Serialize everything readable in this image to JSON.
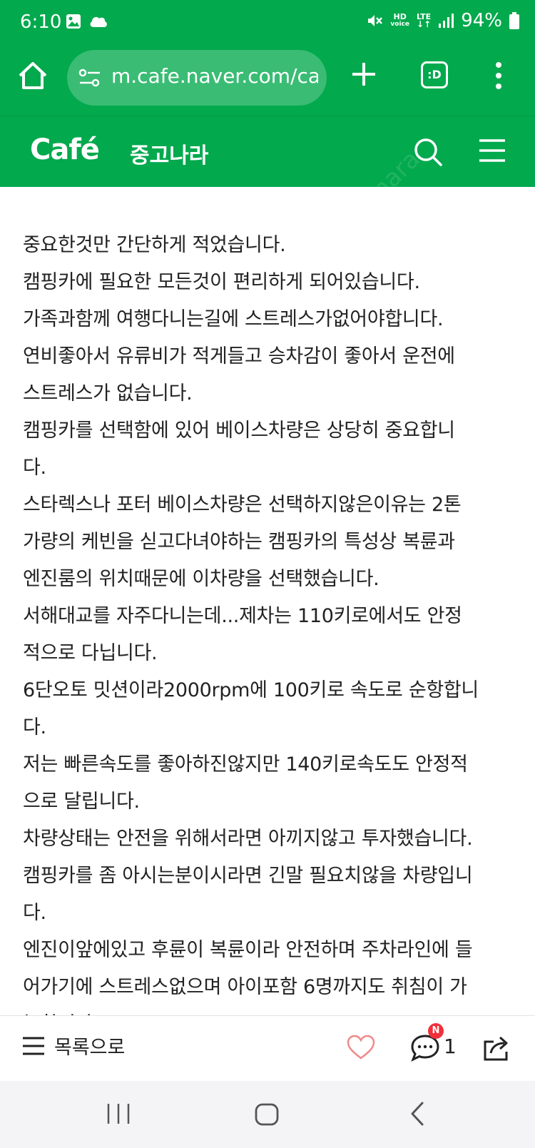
{
  "status_bar": {
    "time": "6:10",
    "hd_voice_label": "HD",
    "hd_voice_sub": "voice",
    "lte_label": "LTE",
    "battery": "94%"
  },
  "browser": {
    "url": "m.cafe.naver.com/ca",
    "tab_count_label": ":D"
  },
  "cafe": {
    "logo": "Café",
    "name": "중고나라"
  },
  "watermark": "joonggonara",
  "article": {
    "lines": [
      "중요한것만 간단하게 적었습니다.",
      "캠핑카에 필요한 모든것이 편리하게 되어있습니다.",
      "가족과함께 여행다니는길에 스트레스가없어야합니다.",
      "연비좋아서 유류비가 적게들고 승차감이 좋아서 운전에",
      "스트레스가 없습니다.",
      "캠핑카를 선택함에 있어 베이스차량은 상당히 중요합니",
      "다.",
      "스타렉스나 포터 베이스차량은 선택하지않은이유는 2톤",
      "가량의 케빈을 싣고다녀야하는 캠핑카의 특성상 복륜과",
      "엔진룸의 위치때문에 이차량을 선택했습니다.",
      "서해대교를 자주다니는데...제차는 110키로에서도 안정",
      "적으로 다닙니다.",
      "6단오토 밋션이라2000rpm에 100키로 속도로 순항합니",
      "다.",
      "저는 빠른속도를 좋아하진않지만 140키로속도도 안정적",
      "으로 달립니다.",
      "차량상태는 안전을 위해서라면 아끼지않고 투자했습니다.",
      "캠핑카를 좀 아시는분이시라면 긴말 필요치않을 차량입니",
      "다.",
      "엔진이앞에있고 후륜이 복륜이라 안전하며 주차라인에 들",
      "어가기에 스트레스없으며 아이포함 6명까지도 취침이 가",
      "능합니다."
    ]
  },
  "action_bar": {
    "list_label": "목록으로",
    "comment_badge": "N",
    "comment_count": "1"
  },
  "colors": {
    "brand_green": "#03a94d",
    "badge_red": "#f0303b",
    "heart_pink": "#f08a8a"
  }
}
